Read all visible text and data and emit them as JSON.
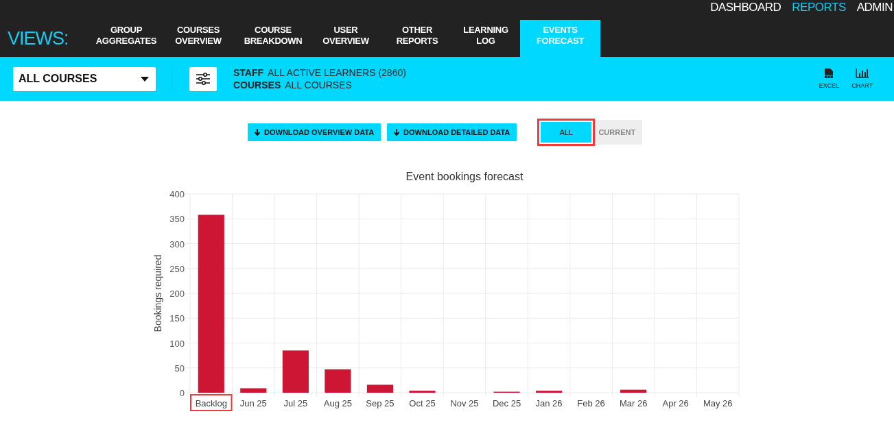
{
  "top_nav": [
    {
      "label": "DASHBOARD",
      "selected": false
    },
    {
      "label": "REPORTS",
      "selected": true
    },
    {
      "label": "ADMIN",
      "selected": false
    }
  ],
  "views_label": "VIEWS:",
  "view_tabs": [
    {
      "label": "GROUP AGGREGATES",
      "selected": false
    },
    {
      "label": "COURSES OVERVIEW",
      "selected": false
    },
    {
      "label": "COURSE BREAKDOWN",
      "selected": false
    },
    {
      "label": "USER OVERVIEW",
      "selected": false
    },
    {
      "label": "OTHER REPORTS",
      "selected": false
    },
    {
      "label": "LEARNING LOG",
      "selected": false
    },
    {
      "label": "EVENTS FORECAST",
      "selected": true
    }
  ],
  "filter_bar": {
    "course_select": "ALL COURSES",
    "filters": [
      {
        "label": "STAFF",
        "value": "ALL ACTIVE LEARNERS (2860)"
      },
      {
        "label": "COURSES",
        "value": "ALL COURSES"
      }
    ],
    "exports": [
      {
        "kind": "excel",
        "label": "EXCEL"
      },
      {
        "kind": "chart",
        "label": "CHART"
      }
    ]
  },
  "downloads": [
    "DOWNLOAD OVERVIEW DATA",
    "DOWNLOAD DETAILED DATA"
  ],
  "scope_toggle": [
    {
      "label": "ALL",
      "selected": true,
      "highlighted": true
    },
    {
      "label": "CURRENT",
      "selected": false,
      "highlighted": false
    }
  ],
  "chart": {
    "category_highlight": [
      true,
      false,
      false,
      false,
      false,
      false,
      false,
      false,
      false,
      false,
      false,
      false,
      false
    ],
    "chart_data": {
      "type": "bar",
      "title": "Event bookings forecast",
      "ylabel": "Bookings required",
      "categories": [
        "Backlog",
        "Jun 25",
        "Jul 25",
        "Aug 25",
        "Sep 25",
        "Oct 25",
        "Nov 25",
        "Dec 25",
        "Jan 26",
        "Feb 26",
        "Mar 26",
        "Apr 26",
        "May 26"
      ],
      "values": [
        358,
        9,
        85,
        47,
        16,
        4,
        0,
        2,
        4,
        0,
        6,
        0,
        0
      ],
      "grid": true,
      "ylim": [
        0,
        400
      ],
      "yticks": [
        0,
        50,
        100,
        150,
        200,
        250,
        300,
        350,
        400
      ]
    }
  }
}
